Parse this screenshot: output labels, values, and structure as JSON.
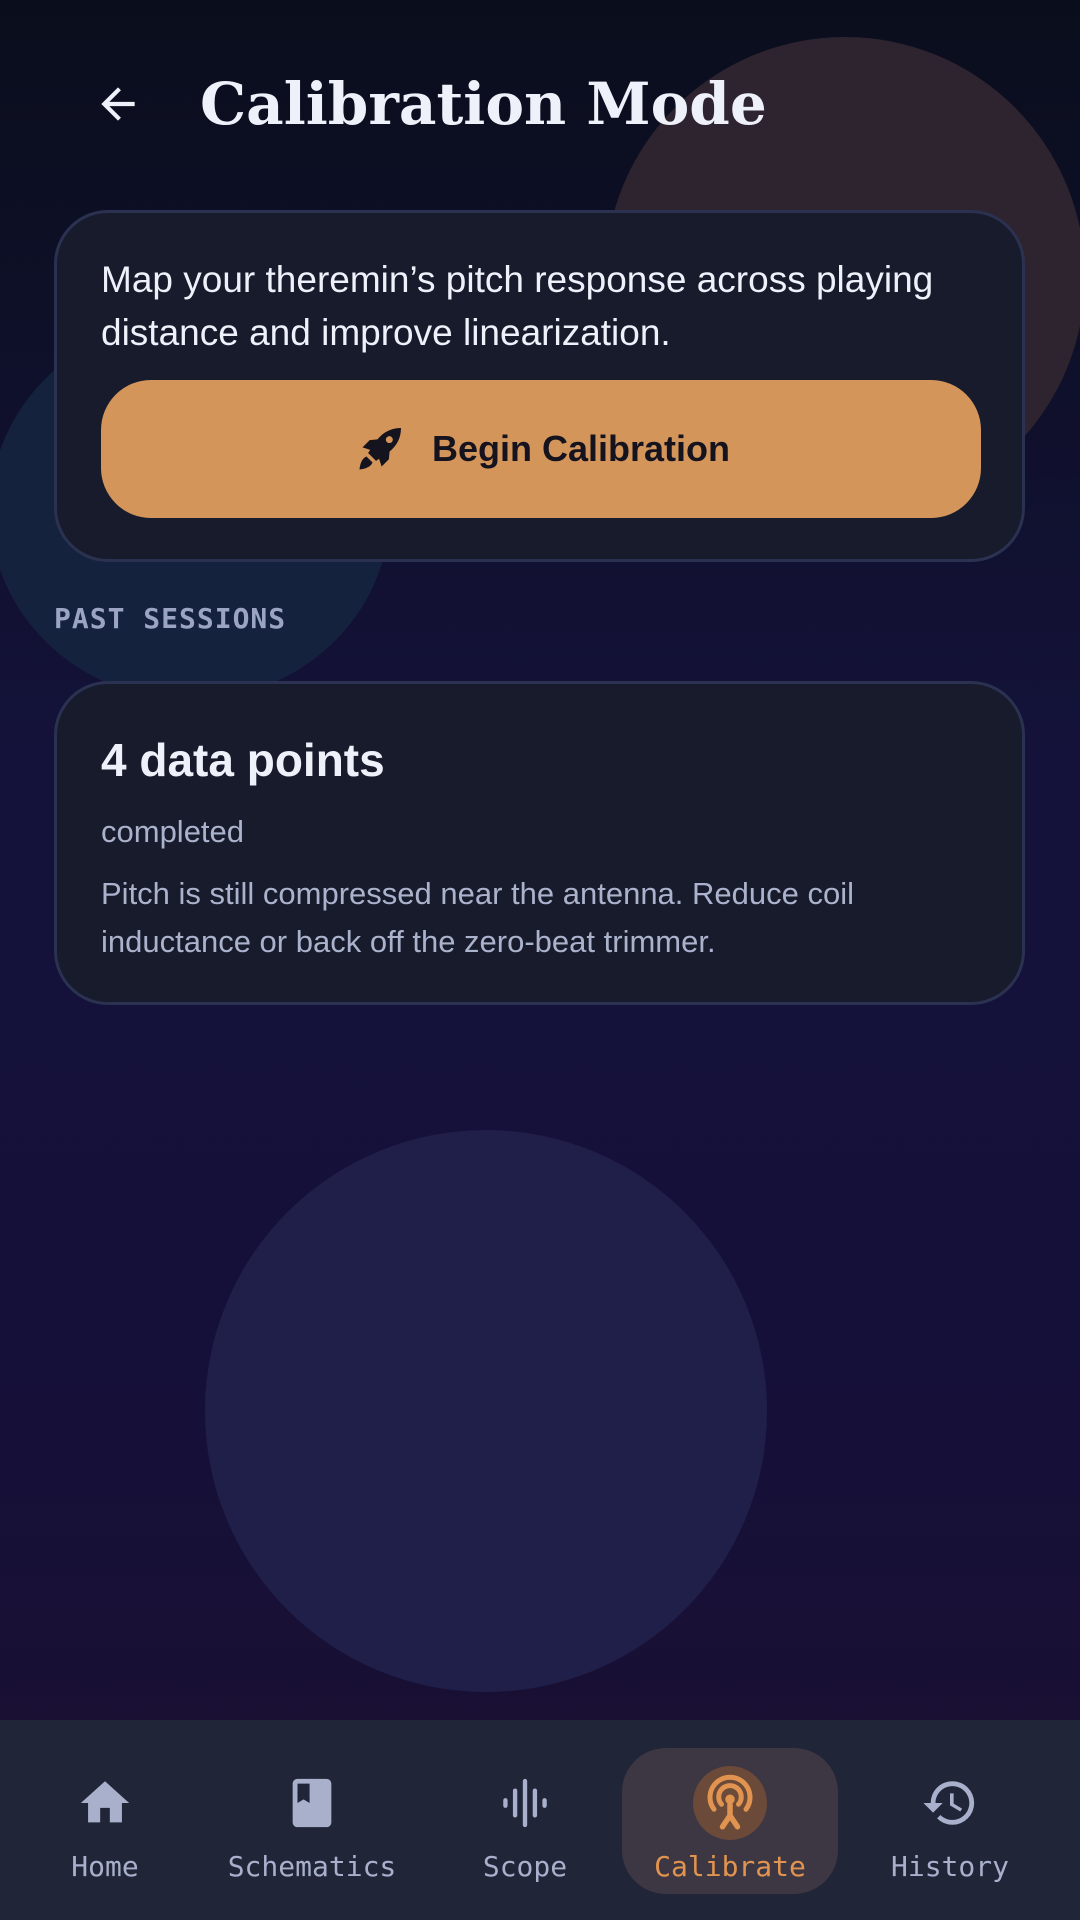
{
  "header": {
    "title": "Calibration Mode",
    "back_icon": "arrow-left-icon"
  },
  "intro": {
    "description": "Map your theremin’s pitch response across playing distance and improve linearization.",
    "button_label": "Begin Calibration",
    "button_icon": "rocket-icon"
  },
  "past_sessions": {
    "heading": "PAST SESSIONS",
    "items": [
      {
        "title": "4 data points",
        "status": "completed",
        "note": "Pitch is still compressed near the antenna. Reduce coil inductance or back off the zero-beat trimmer."
      }
    ]
  },
  "nav": {
    "items": [
      {
        "label": "Home",
        "icon": "home-icon"
      },
      {
        "label": "Schematics",
        "icon": "book-icon"
      },
      {
        "label": "Scope",
        "icon": "waveform-icon"
      },
      {
        "label": "Calibrate",
        "icon": "antenna-icon",
        "active": true
      },
      {
        "label": "History",
        "icon": "history-icon"
      }
    ]
  },
  "colors": {
    "accent": "#d4955b",
    "active_label": "#e1944f",
    "card_bg": "#171b2c",
    "nav_bg": "#212538"
  }
}
